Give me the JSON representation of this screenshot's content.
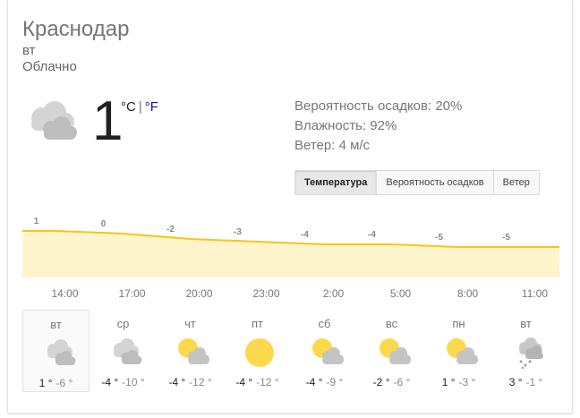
{
  "location": "Краснодар",
  "day": "вт",
  "condition": "Облачно",
  "current": {
    "temperature": "1",
    "unit_c": "°C",
    "unit_sep": "|",
    "unit_f": "°F",
    "icon": "cloudy-icon"
  },
  "details": {
    "precipitation": "Вероятность осадков: 20%",
    "humidity": "Влажность: 92%",
    "wind": "Ветер: 4 м/с"
  },
  "tabs": [
    {
      "label": "Температура",
      "active": true
    },
    {
      "label": "Вероятность осадков",
      "active": false
    },
    {
      "label": "Ветер",
      "active": false
    }
  ],
  "colors": {
    "line": "#f5c518",
    "fill": "#fff5cc",
    "sun": "#fcd94c",
    "cloud": "#c8c8c8"
  },
  "chart_data": {
    "type": "area",
    "x": [
      "14:00",
      "17:00",
      "20:00",
      "23:00",
      "2:00",
      "5:00",
      "8:00",
      "11:00"
    ],
    "values": [
      1,
      0,
      -2,
      -3,
      -4,
      -4,
      -5,
      -5
    ],
    "labels": [
      "1",
      "0",
      "-2",
      "-3",
      "-4",
      "-4",
      "-5",
      "-5"
    ]
  },
  "forecast": [
    {
      "day": "вт",
      "max": "1 °",
      "min": "-6 °",
      "icon": "cloudy-icon",
      "selected": true
    },
    {
      "day": "ср",
      "max": "-4 °",
      "min": "-10 °",
      "icon": "cloudy-icon",
      "selected": false
    },
    {
      "day": "чт",
      "max": "-4 °",
      "min": "-12 °",
      "icon": "partly-cloudy-icon",
      "selected": false
    },
    {
      "day": "пт",
      "max": "-4 °",
      "min": "-12 °",
      "icon": "sunny-icon",
      "selected": false
    },
    {
      "day": "сб",
      "max": "-4 °",
      "min": "-9 °",
      "icon": "partly-cloudy-icon",
      "selected": false
    },
    {
      "day": "вс",
      "max": "-2 °",
      "min": "-6 °",
      "icon": "partly-cloudy-icon",
      "selected": false
    },
    {
      "day": "пн",
      "max": "1 °",
      "min": "-3 °",
      "icon": "partly-cloudy-icon",
      "selected": false
    },
    {
      "day": "вт",
      "max": "3 °",
      "min": "-1 °",
      "icon": "snow-cloudy-icon",
      "selected": false
    }
  ]
}
